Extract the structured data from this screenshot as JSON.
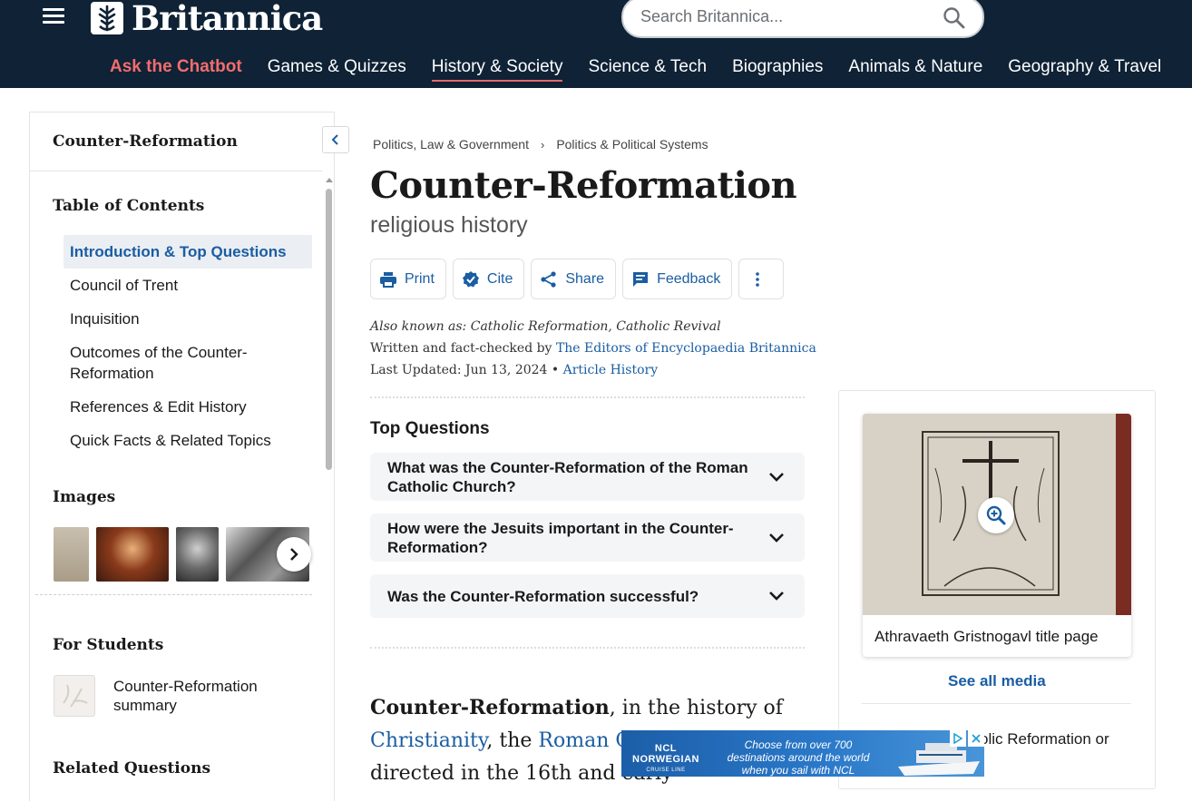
{
  "header": {
    "brand": "Britannica",
    "search_placeholder": "Search Britannica...",
    "nav": [
      {
        "label": "Ask the Chatbot"
      },
      {
        "label": "Games & Quizzes"
      },
      {
        "label": "History & Society"
      },
      {
        "label": "Science & Tech"
      },
      {
        "label": "Biographies"
      },
      {
        "label": "Animals & Nature"
      },
      {
        "label": "Geography & Travel"
      }
    ],
    "active_nav": "History & Society"
  },
  "sidebar": {
    "title": "Counter-Reformation",
    "toc_heading": "Table of Contents",
    "toc": [
      {
        "label": "Introduction & Top Questions",
        "active": true
      },
      {
        "label": "Council of Trent"
      },
      {
        "label": "Inquisition"
      },
      {
        "label": "Outcomes of the Counter-Reformation"
      },
      {
        "label": "References & Edit History"
      },
      {
        "label": "Quick Facts & Related Topics"
      }
    ],
    "images_heading": "Images",
    "for_students_heading": "For Students",
    "student_item": "Counter-Reformation summary",
    "related_heading": "Related Questions"
  },
  "breadcrumb": [
    "Politics, Law & Government",
    "Politics & Political Systems"
  ],
  "article": {
    "title": "Counter-Reformation",
    "subtitle": "religious history",
    "actions": {
      "print": "Print",
      "cite": "Cite",
      "share": "Share",
      "feedback": "Feedback"
    },
    "also_known": "Also known as: Catholic Reformation, Catholic Revival",
    "written_prefix": "Written and fact-checked by",
    "written_by": "The Editors of Encyclopaedia Britannica",
    "updated_prefix": "Last Updated: Jun 13, 2024",
    "bullet": "•",
    "article_history": "Article History",
    "top_questions_heading": "Top Questions",
    "questions": [
      "What was the Counter-Reformation of the Roman Catholic Church?",
      "How were the Jesuits important in the Counter-Reformation?",
      "Was the Counter-Reformation successful?"
    ],
    "lead_bold": "Counter-Reformation",
    "lead_1": ", in the history of",
    "lead_link1": "Christianity",
    "lead_2": ", the",
    "lead_link2": "Roman Catholic",
    "lead_3": "efforts directed in the 16th and early"
  },
  "media": {
    "caption": "Athravaeth Gristnogavl title page",
    "see_all": "See all media",
    "panel_text": "olic Reformation or"
  },
  "ad": {
    "brand": "NCL",
    "brand_name": "NORWEGIAN",
    "brand_sub": "CRUISE LINE",
    "copy": "Choose from over 700 destinations around the world when you sail with NCL"
  },
  "colors": {
    "header_bg": "#0f2236",
    "link": "#1a5da2",
    "chatbot": "#f26d6d"
  }
}
